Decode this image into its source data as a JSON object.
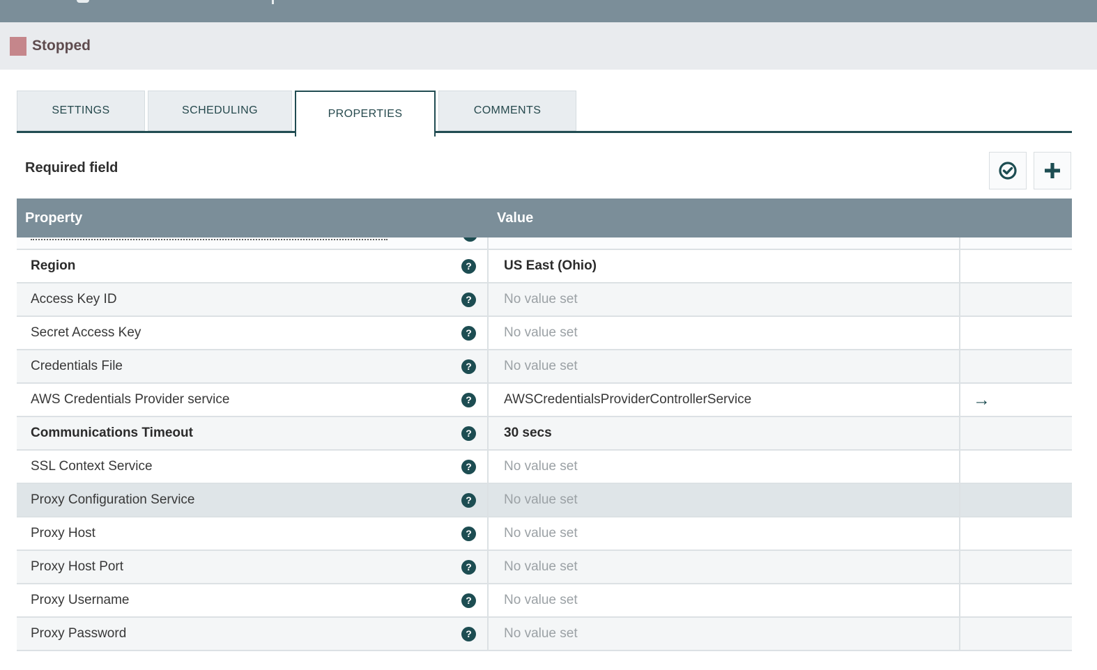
{
  "titlebar": {
    "background": "#7b8e99"
  },
  "status": {
    "label": "Stopped",
    "indicator_color": "#c5868b"
  },
  "tabs": [
    {
      "label": "SETTINGS",
      "active": false
    },
    {
      "label": "SCHEDULING",
      "active": false
    },
    {
      "label": "PROPERTIES",
      "active": true
    },
    {
      "label": "COMMENTS",
      "active": false
    }
  ],
  "toolbar": {
    "required_label": "Required field",
    "icons": {
      "verify": "circle-checkmark",
      "add": "plus"
    }
  },
  "icons": {
    "help": "question-mark-circle",
    "go_to_service": "right-arrow",
    "arrow_glyph": "→",
    "help_glyph": "?"
  },
  "colors": {
    "accent_teal": "#214c52",
    "header_slate": "#7b8e99",
    "stopped_red": "#c5868b",
    "empty_value_gray": "#9ba1a5",
    "hover_row": "#dfe5e8"
  },
  "table": {
    "columns": [
      "Property",
      "Value"
    ],
    "rows": [
      {
        "name": "",
        "value": "",
        "clipped": true,
        "required": false,
        "no_value": false,
        "action": null
      },
      {
        "name": "Region",
        "value": "US East (Ohio)",
        "clipped": false,
        "required": true,
        "no_value": false,
        "action": null
      },
      {
        "name": "Access Key ID",
        "value": "No value set",
        "clipped": false,
        "required": false,
        "no_value": true,
        "action": null
      },
      {
        "name": "Secret Access Key",
        "value": "No value set",
        "clipped": false,
        "required": false,
        "no_value": true,
        "action": null
      },
      {
        "name": "Credentials File",
        "value": "No value set",
        "clipped": false,
        "required": false,
        "no_value": true,
        "action": null
      },
      {
        "name": "AWS Credentials Provider service",
        "value": "AWSCredentialsProviderControllerService",
        "clipped": false,
        "required": false,
        "no_value": false,
        "action": "go-to-service"
      },
      {
        "name": "Communications Timeout",
        "value": "30 secs",
        "clipped": false,
        "required": true,
        "no_value": false,
        "action": null
      },
      {
        "name": "SSL Context Service",
        "value": "No value set",
        "clipped": false,
        "required": false,
        "no_value": true,
        "action": null
      },
      {
        "name": "Proxy Configuration Service",
        "value": "No value set",
        "clipped": false,
        "required": false,
        "no_value": true,
        "hover": true,
        "action": null
      },
      {
        "name": "Proxy Host",
        "value": "No value set",
        "clipped": false,
        "required": false,
        "no_value": true,
        "action": null
      },
      {
        "name": "Proxy Host Port",
        "value": "No value set",
        "clipped": false,
        "required": false,
        "no_value": true,
        "action": null
      },
      {
        "name": "Proxy Username",
        "value": "No value set",
        "clipped": false,
        "required": false,
        "no_value": true,
        "action": null
      },
      {
        "name": "Proxy Password",
        "value": "No value set",
        "clipped": false,
        "required": false,
        "no_value": true,
        "action": null
      }
    ]
  }
}
